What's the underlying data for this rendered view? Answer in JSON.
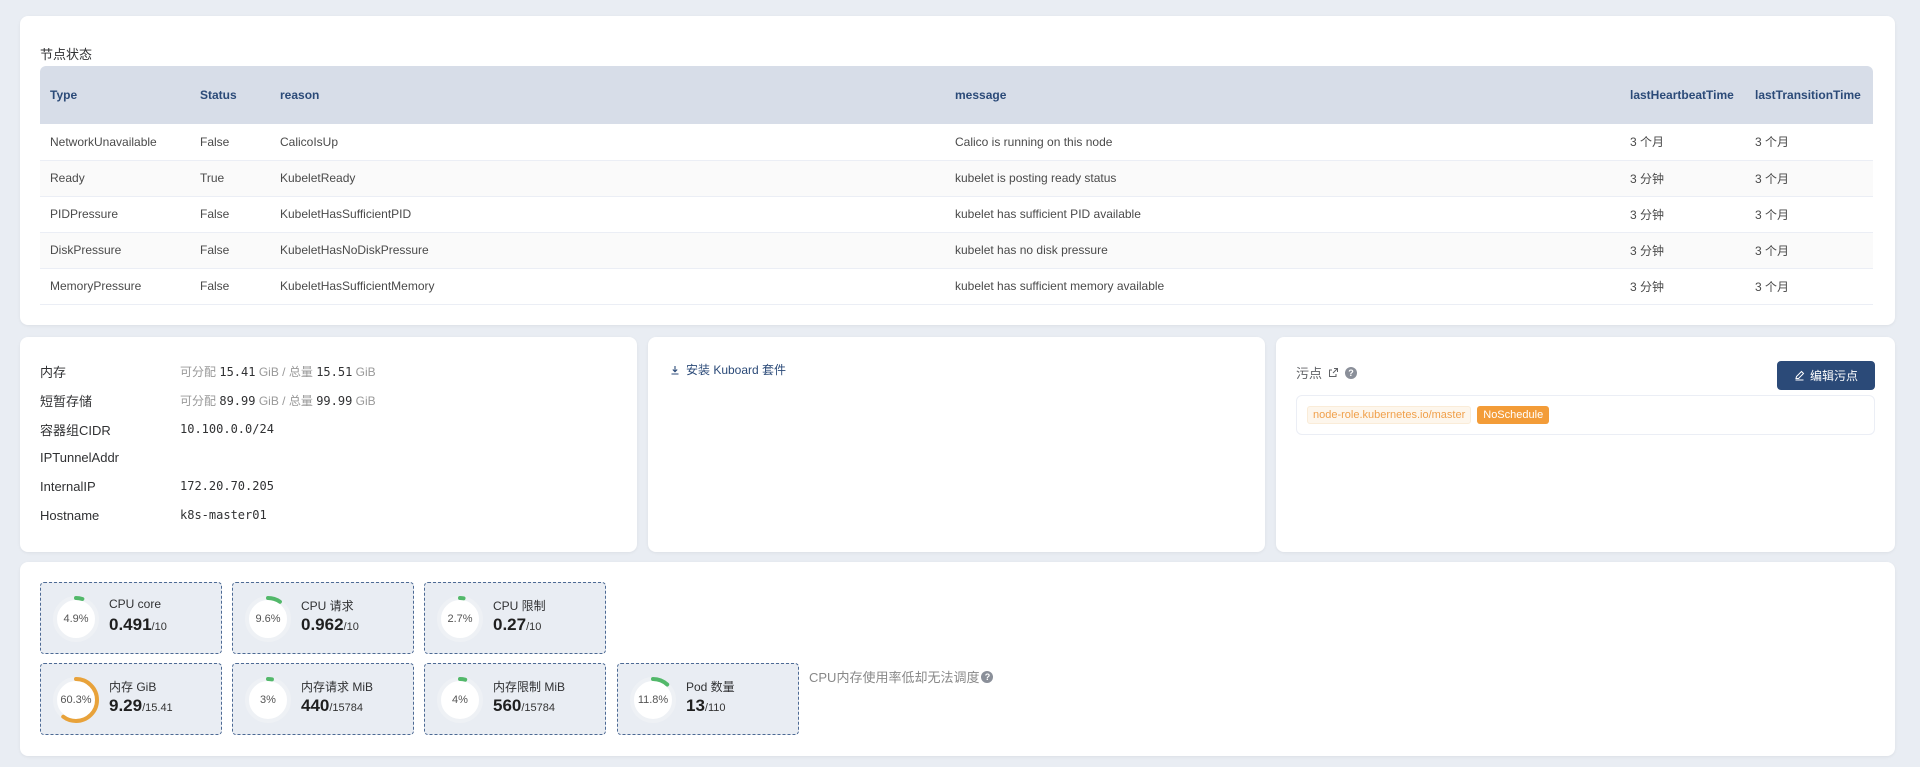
{
  "conditions": {
    "title": "节点状态",
    "headers": [
      "Type",
      "Status",
      "reason",
      "message",
      "lastHeartbeatTime",
      "lastTransitionTime"
    ],
    "rows": [
      [
        "NetworkUnavailable",
        "False",
        "CalicoIsUp",
        "Calico is running on this node",
        "3 个月",
        "3 个月"
      ],
      [
        "Ready",
        "True",
        "KubeletReady",
        "kubelet is posting ready status",
        "3 分钟",
        "3 个月"
      ],
      [
        "PIDPressure",
        "False",
        "KubeletHasSufficientPID",
        "kubelet has sufficient PID available",
        "3 分钟",
        "3 个月"
      ],
      [
        "DiskPressure",
        "False",
        "KubeletHasNoDiskPressure",
        "kubelet has no disk pressure",
        "3 分钟",
        "3 个月"
      ],
      [
        "MemoryPressure",
        "False",
        "KubeletHasSufficientMemory",
        "kubelet has sufficient memory available",
        "3 分钟",
        "3 个月"
      ]
    ]
  },
  "info": {
    "memory": {
      "label": "内存",
      "alloc_prefix": "可分配",
      "alloc": "15.41",
      "unit1": "GiB / 总量",
      "total": "15.51",
      "unit2": "GiB"
    },
    "ephemeral": {
      "label": "短暂存储",
      "alloc_prefix": "可分配",
      "alloc": "89.99",
      "unit1": "GiB / 总量",
      "total": "99.99",
      "unit2": "GiB"
    },
    "cidr": {
      "label": "容器组CIDR",
      "value": "10.100.0.0/24"
    },
    "tunnel": {
      "label": "IPTunnelAddr",
      "value": ""
    },
    "internal_ip": {
      "label": "InternalIP",
      "value": "172.20.70.205"
    },
    "hostname": {
      "label": "Hostname",
      "value": "k8s-master01"
    }
  },
  "kuboard": {
    "link": "安装 Kuboard 套件"
  },
  "taints": {
    "title": "污点",
    "edit_button": "编辑污点",
    "key": "node-role.kubernetes.io/master",
    "effect": "NoSchedule"
  },
  "stats": {
    "note": "CPU内存使用率低却无法调度",
    "items": [
      {
        "label": "CPU core",
        "percent": 4.9,
        "percent_text": "4.9%",
        "value": "0.491",
        "total": "/10",
        "color": "#52b86a"
      },
      {
        "label": "CPU 请求",
        "percent": 9.6,
        "percent_text": "9.6%",
        "value": "0.962",
        "total": "/10",
        "color": "#52b86a"
      },
      {
        "label": "CPU 限制",
        "percent": 2.7,
        "percent_text": "2.7%",
        "value": "0.27",
        "total": "/10",
        "color": "#52b86a"
      },
      {
        "label": "内存 GiB",
        "percent": 60.3,
        "percent_text": "60.3%",
        "value": "9.29",
        "total": "/15.41",
        "color": "#e8a23a"
      },
      {
        "label": "内存请求 MiB",
        "percent": 3,
        "percent_text": "3%",
        "value": "440",
        "total": "/15784",
        "color": "#52b86a"
      },
      {
        "label": "内存限制 MiB",
        "percent": 4,
        "percent_text": "4%",
        "value": "560",
        "total": "/15784",
        "color": "#52b86a"
      },
      {
        "label": "Pod 数量",
        "percent": 11.8,
        "percent_text": "11.8%",
        "value": "13",
        "total": "/110",
        "color": "#52b86a"
      }
    ]
  }
}
